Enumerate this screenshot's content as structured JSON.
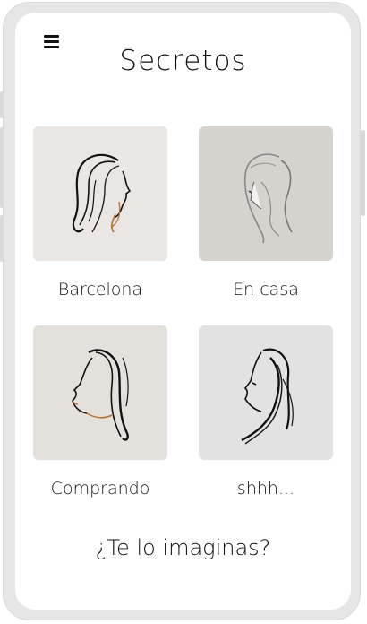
{
  "header": {
    "menu_icon": "hamburger-menu-icon",
    "title": "Secretos"
  },
  "gallery": {
    "items": [
      {
        "label": "Barcelona",
        "image": "woman-profile-illustration",
        "bg": "#e9e6e3"
      },
      {
        "label": "En casa",
        "image": "woman-profile-illustration",
        "bg": "#d6d3ce"
      },
      {
        "label": "Comprando",
        "image": "woman-profile-illustration",
        "bg": "#e4e1dd"
      },
      {
        "label": "shhh...",
        "image": "woman-profile-illustration",
        "bg": "#e2e2e2"
      }
    ]
  },
  "footer": {
    "question": "¿Te lo imaginas?"
  },
  "colors": {
    "frame": "#e6e6e6",
    "screen": "#ffffff",
    "text": "#111111",
    "accent_copper": "#b8753e"
  }
}
